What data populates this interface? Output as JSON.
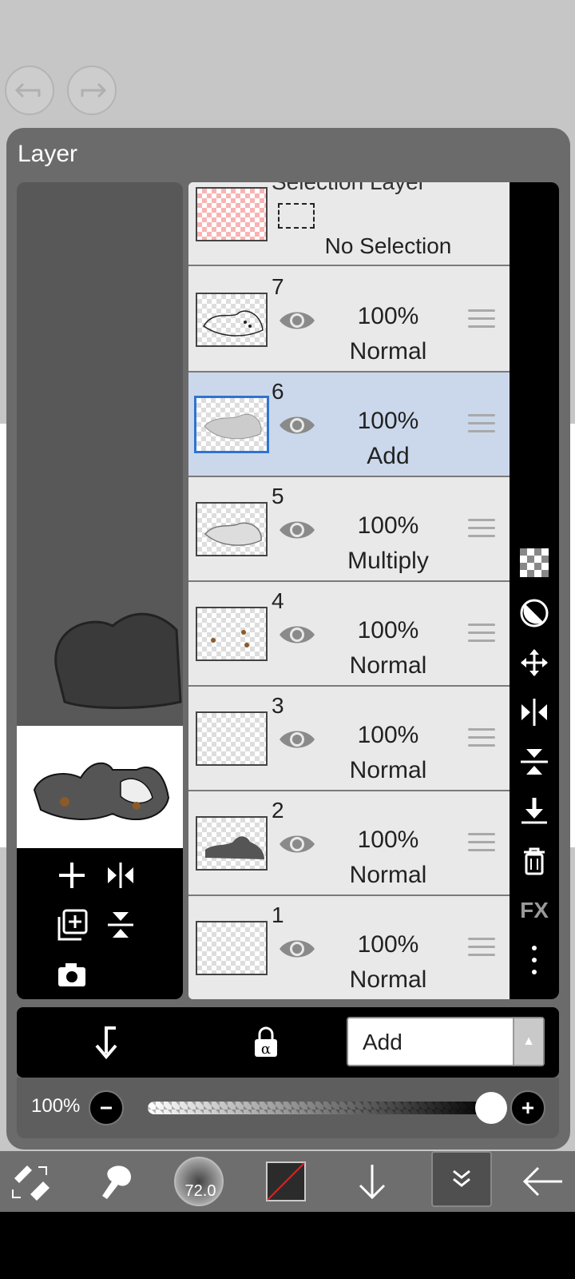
{
  "panel": {
    "title": "Layer"
  },
  "selection_layer": {
    "title": "Selection Layer",
    "status": "No Selection"
  },
  "layers": [
    {
      "number": "7",
      "opacity": "100%",
      "blend": "Normal",
      "selected": false
    },
    {
      "number": "6",
      "opacity": "100%",
      "blend": "Add",
      "selected": true
    },
    {
      "number": "5",
      "opacity": "100%",
      "blend": "Multiply",
      "selected": false
    },
    {
      "number": "4",
      "opacity": "100%",
      "blend": "Normal",
      "selected": false
    },
    {
      "number": "3",
      "opacity": "100%",
      "blend": "Normal",
      "selected": false
    },
    {
      "number": "2",
      "opacity": "100%",
      "blend": "Normal",
      "selected": false
    },
    {
      "number": "1",
      "opacity": "100%",
      "blend": "Normal",
      "selected": false
    }
  ],
  "side_tools": {
    "fx_label": "FX"
  },
  "blend_mode": {
    "selected": "Add"
  },
  "opacity": {
    "label": "100%",
    "value": 1.0
  },
  "brush": {
    "size": "72.0"
  },
  "colors": {
    "accent": "#2f74d0",
    "selected_row": "#cbd8ec"
  }
}
